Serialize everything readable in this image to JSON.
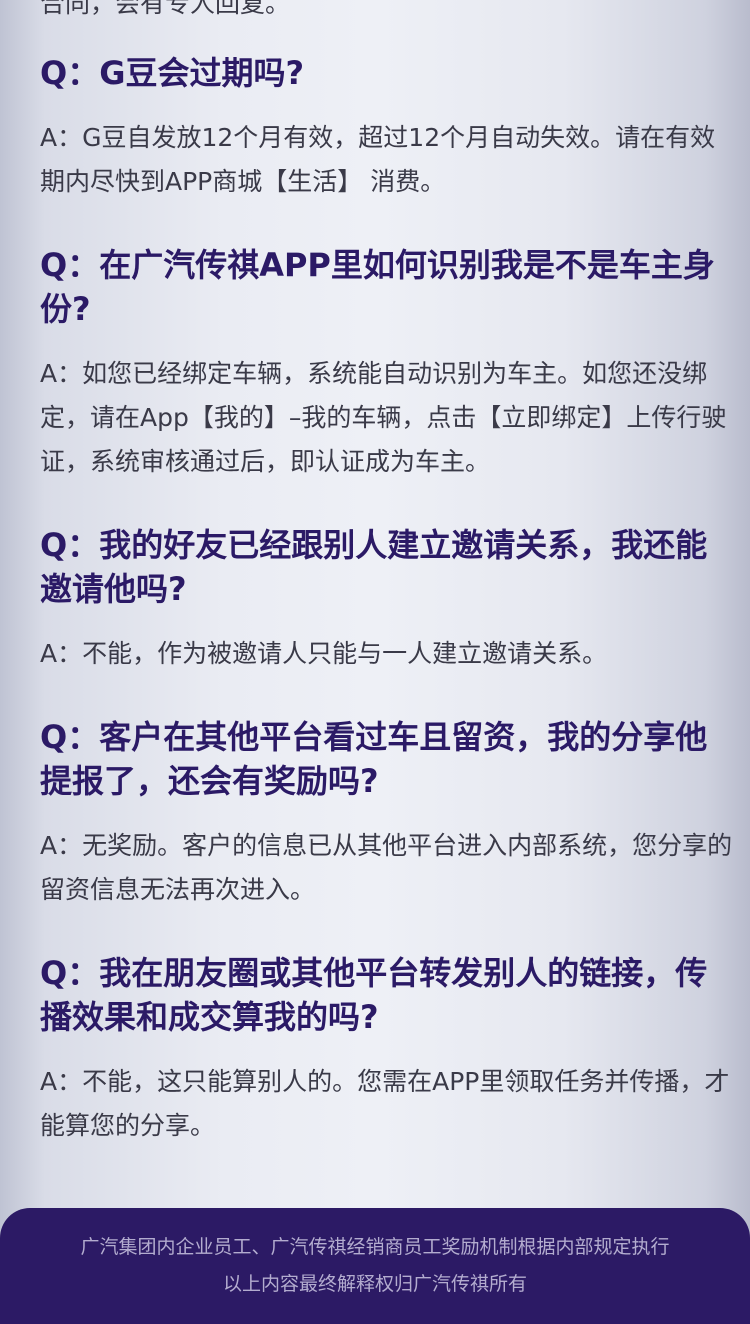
{
  "faq": {
    "partial_top_text": "合同，会有专人回复。",
    "items": [
      {
        "question": "Q：G豆会过期吗?",
        "answer": "A：G豆自发放12个月有效，超过12个月自动失效。请在有效期内尽快到APP商城【生活】 消费。"
      },
      {
        "question": "Q：在广汽传祺APP里如何识别我是不是车主身份?",
        "answer": "A：如您已经绑定车辆，系统能自动识别为车主。如您还没绑定，请在App【我的】–我的车辆，点击【立即绑定】上传行驶证，系统审核通过后，即认证成为车主。"
      },
      {
        "question": "Q：我的好友已经跟别人建立邀请关系，我还能邀请他吗?",
        "answer": "A：不能，作为被邀请人只能与一人建立邀请关系。"
      },
      {
        "question": "Q：客户在其他平台看过车且留资，我的分享他提报了，还会有奖励吗?",
        "answer": "A：无奖励。客户的信息已从其他平台进入内部系统，您分享的留资信息无法再次进入。"
      },
      {
        "question": "Q：我在朋友圈或其他平台转发别人的链接，传播效果和成交算我的吗?",
        "answer": "A：不能，这只能算别人的。您需在APP里领取任务并传播，才能算您的分享。"
      }
    ]
  },
  "footer": {
    "line1": "广汽集团内企业员工、广汽传祺经销商员工奖励机制根据内部规定执行",
    "line2": "以上内容最终解释权归广汽传祺所有"
  }
}
